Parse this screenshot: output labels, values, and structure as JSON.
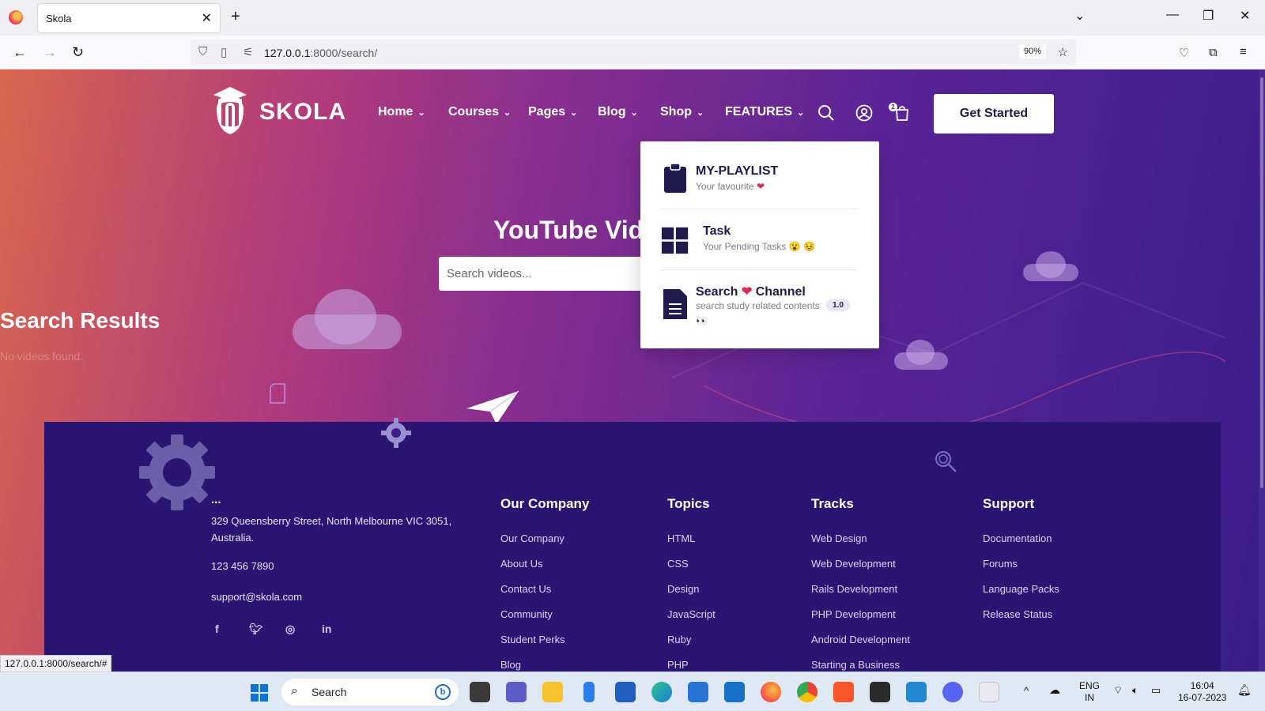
{
  "browser": {
    "tab_title": "Skola",
    "tab_close": "✕",
    "new_tab": "+",
    "url_host": "127.0.0.1",
    "url_rest": ":8000/search/",
    "zoom": "90%",
    "status_url": "127.0.0.1:8000/search/#",
    "window_controls": [
      "⌄",
      "—",
      "❐",
      "✕"
    ]
  },
  "header": {
    "brand": "SKOLA",
    "menu": [
      {
        "label": "Home"
      },
      {
        "label": "Courses"
      },
      {
        "label": "Pages"
      },
      {
        "label": "Blog"
      },
      {
        "label": "Shop"
      },
      {
        "label": "FEATURES"
      }
    ],
    "cart_count": "2",
    "cta_label": "Get Started"
  },
  "hero": {
    "title": "YouTube Vide",
    "search_placeholder": "Search videos..."
  },
  "results": {
    "title": "Search Results",
    "empty_text": "No videos found."
  },
  "features_dropdown": {
    "items": [
      {
        "title": "MY-PLAYLIST",
        "subtitle": "Your favourite",
        "emoji": "❤️"
      },
      {
        "title": "Task",
        "subtitle": "Your Pending Tasks",
        "emoji": "😮 😣"
      },
      {
        "title_a": "Search",
        "title_heart": "❤️",
        "title_b": "Channel",
        "subtitle": "search study related contents",
        "badge": "1.0",
        "emoji": "👀"
      }
    ]
  },
  "footer": {
    "dots": "...",
    "address": "329 Queensberry Street, North Melbourne VIC 3051, Australia.",
    "phone": "123 456 7890",
    "email": "support@skola.com",
    "social": [
      "f",
      "t",
      "ig",
      "in"
    ],
    "columns": [
      {
        "title": "Our Company",
        "links": [
          "Our Company",
          "About Us",
          "Contact Us",
          "Community",
          "Student Perks",
          "Blog"
        ]
      },
      {
        "title": "Topics",
        "links": [
          "HTML",
          "CSS",
          "Design",
          "JavaScript",
          "Ruby",
          "PHP"
        ]
      },
      {
        "title": "Tracks",
        "links": [
          "Web Design",
          "Web Development",
          "Rails Development",
          "PHP Development",
          "Android Development",
          "Starting a Business"
        ]
      },
      {
        "title": "Support",
        "links": [
          "Documentation",
          "Forums",
          "Language Packs",
          "Release Status"
        ]
      }
    ]
  },
  "taskbar": {
    "search_label": "Search",
    "lang_top": "ENG",
    "lang_bottom": "IN",
    "time": "16:04",
    "date": "16-07-2023"
  },
  "colors": {
    "brand_dark": "#1f1b4d",
    "footer_bg": "#2b1572",
    "accent_heart": "#e0245e"
  }
}
